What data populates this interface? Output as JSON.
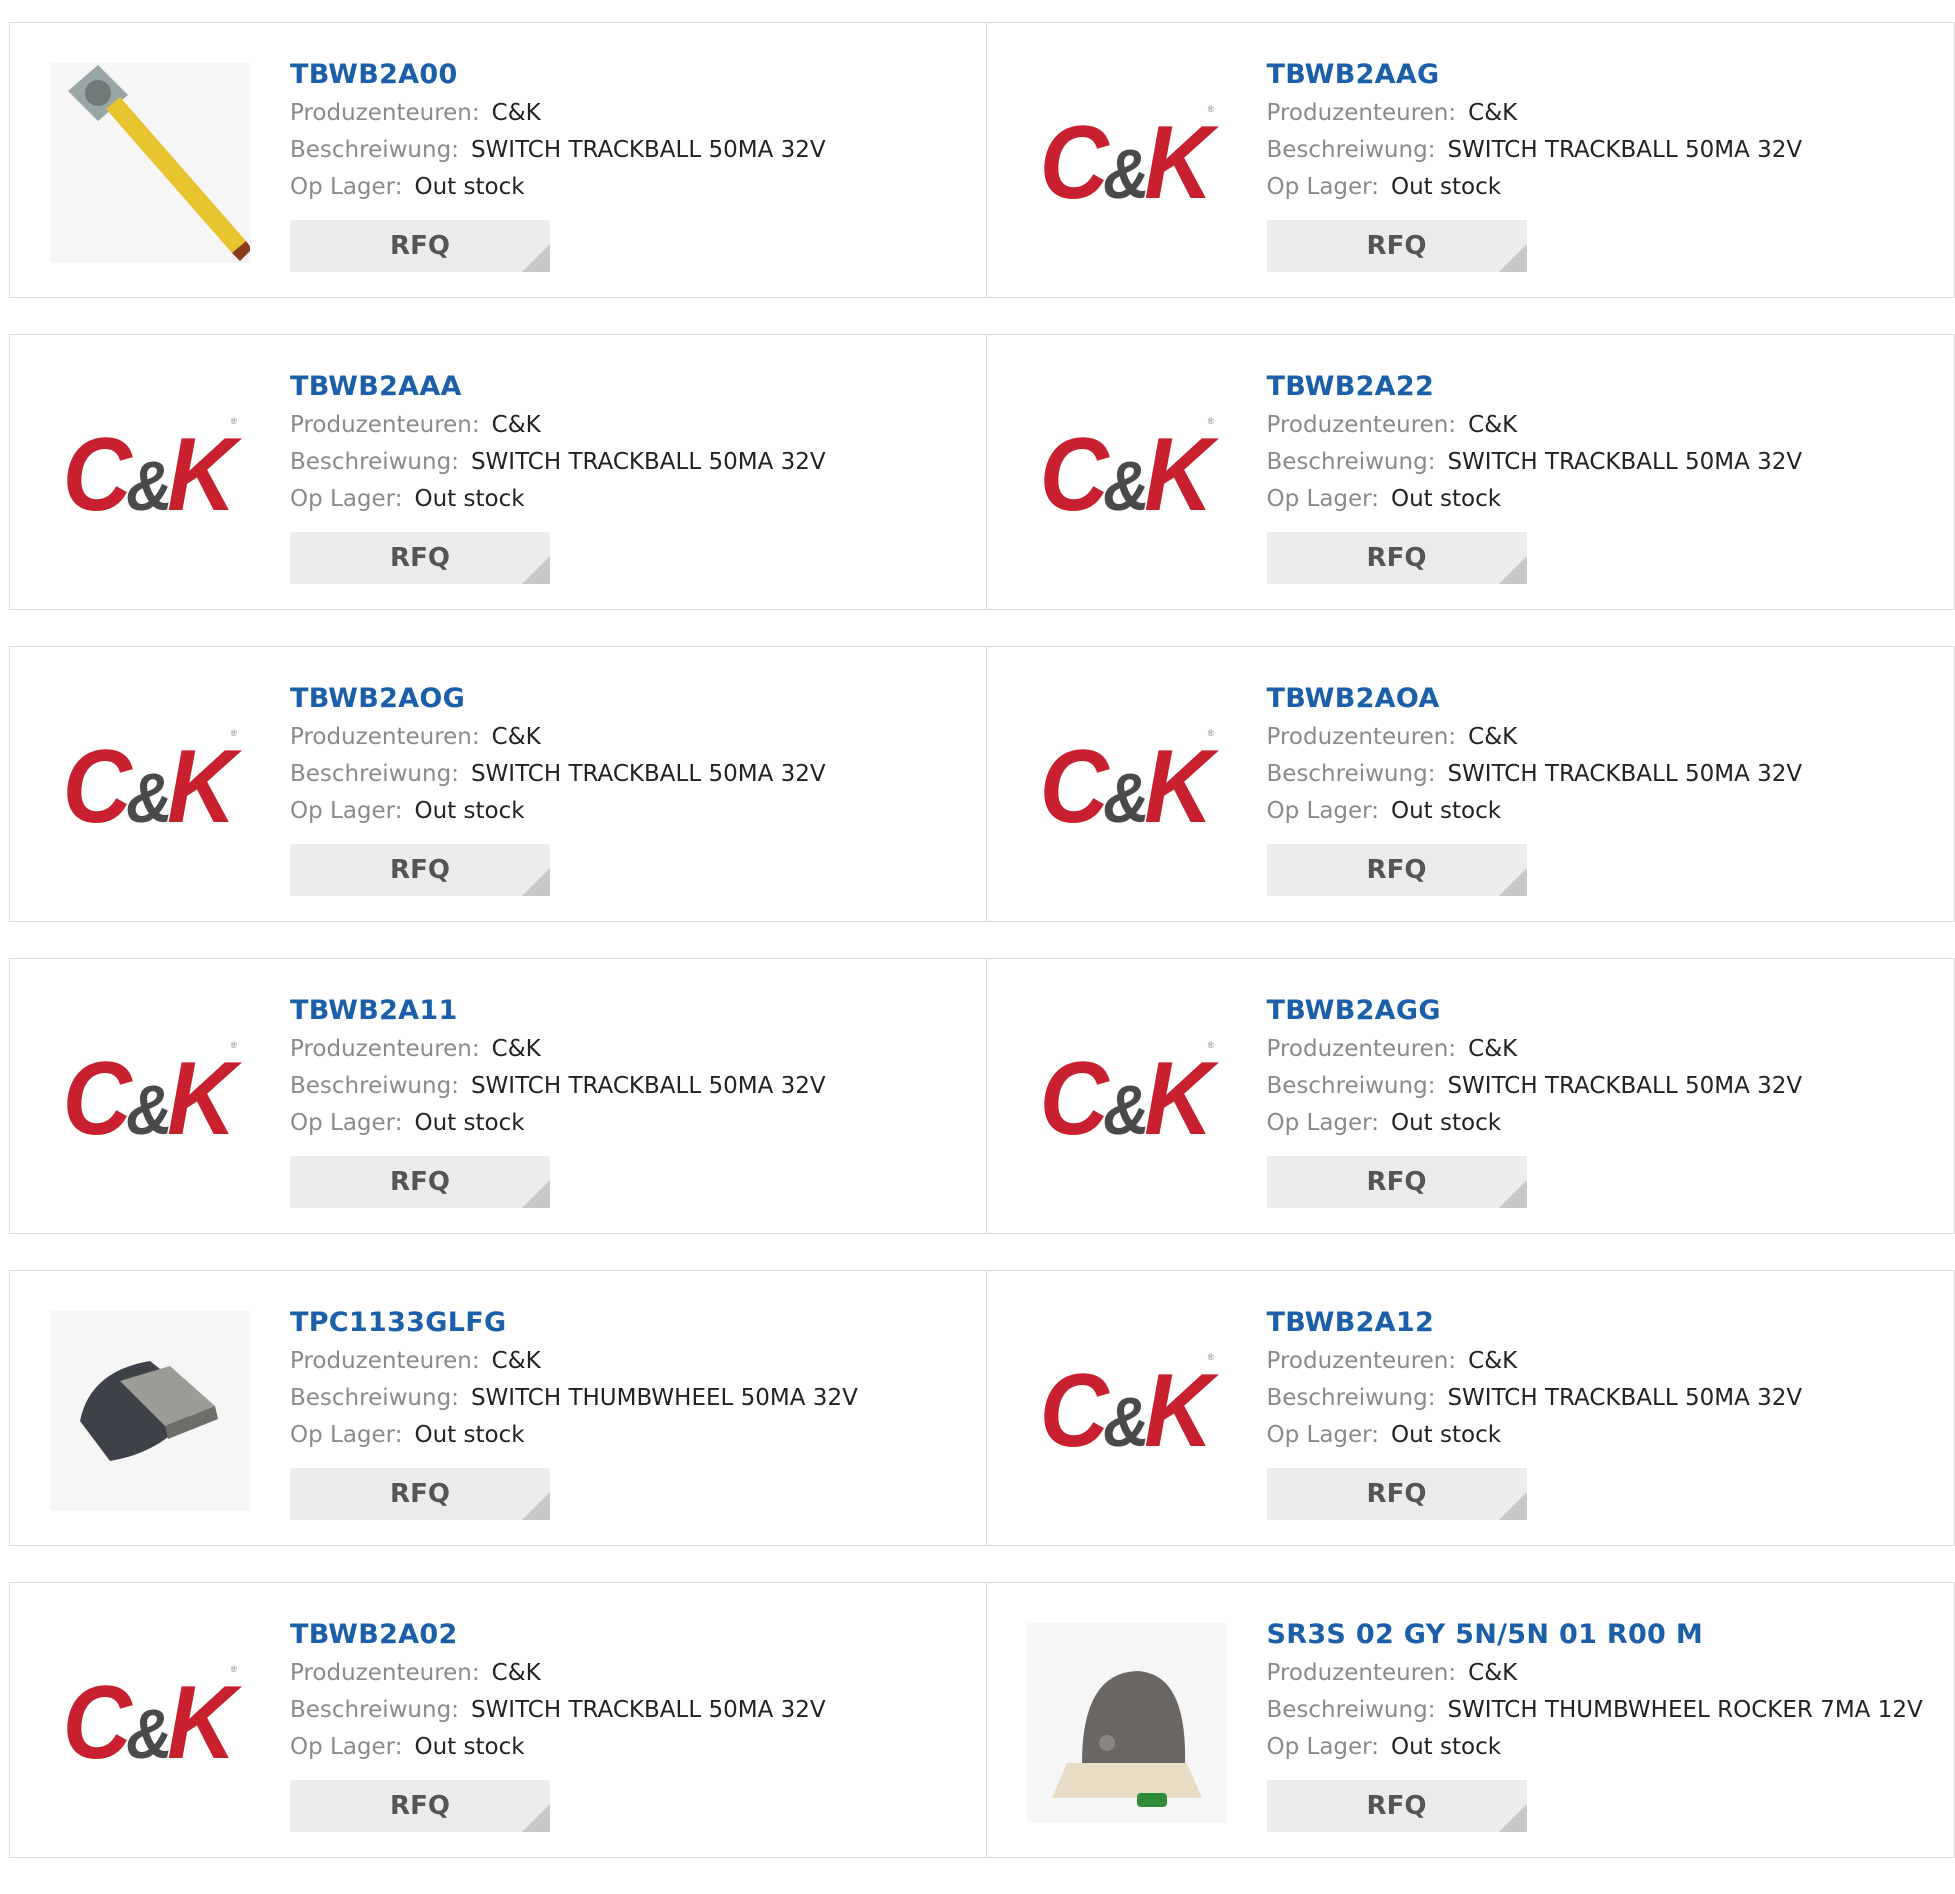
{
  "labels": {
    "manufacturer": "Produzenteuren:",
    "description": "Beschreiwung:",
    "stock": "Op Lager:",
    "rfq": "RFQ"
  },
  "logo": {
    "brand_c": "C",
    "brand_amp": "&",
    "brand_k": "K",
    "reg": "®"
  },
  "products": [
    {
      "pn": "TBWB2A00",
      "mfr": "C&K",
      "desc": "SWITCH TRACKBALL 50MA 32V",
      "stock": "Out stock",
      "image": "trackball-flex-photo"
    },
    {
      "pn": "TBWB2AAG",
      "mfr": "C&K",
      "desc": "SWITCH TRACKBALL 50MA 32V",
      "stock": "Out stock",
      "image": "ck-logo"
    },
    {
      "pn": "TBWB2AAA",
      "mfr": "C&K",
      "desc": "SWITCH TRACKBALL 50MA 32V",
      "stock": "Out stock",
      "image": "ck-logo"
    },
    {
      "pn": "TBWB2A22",
      "mfr": "C&K",
      "desc": "SWITCH TRACKBALL 50MA 32V",
      "stock": "Out stock",
      "image": "ck-logo"
    },
    {
      "pn": "TBWB2AOG",
      "mfr": "C&K",
      "desc": "SWITCH TRACKBALL 50MA 32V",
      "stock": "Out stock",
      "image": "ck-logo"
    },
    {
      "pn": "TBWB2AOA",
      "mfr": "C&K",
      "desc": "SWITCH TRACKBALL 50MA 32V",
      "stock": "Out stock",
      "image": "ck-logo"
    },
    {
      "pn": "TBWB2A11",
      "mfr": "C&K",
      "desc": "SWITCH TRACKBALL 50MA 32V",
      "stock": "Out stock",
      "image": "ck-logo"
    },
    {
      "pn": "TBWB2AGG",
      "mfr": "C&K",
      "desc": "SWITCH TRACKBALL 50MA 32V",
      "stock": "Out stock",
      "image": "ck-logo"
    },
    {
      "pn": "TPC1133GLFG",
      "mfr": "C&K",
      "desc": "SWITCH THUMBWHEEL 50MA 32V",
      "stock": "Out stock",
      "image": "thumbwheel-photo"
    },
    {
      "pn": "TBWB2A12",
      "mfr": "C&K",
      "desc": "SWITCH TRACKBALL 50MA 32V",
      "stock": "Out stock",
      "image": "ck-logo"
    },
    {
      "pn": "TBWB2A02",
      "mfr": "C&K",
      "desc": "SWITCH TRACKBALL 50MA 32V",
      "stock": "Out stock",
      "image": "ck-logo"
    },
    {
      "pn": "SR3S 02 GY 5N/5N 01 R00 M",
      "mfr": "C&K",
      "desc": "SWITCH THUMBWHEEL ROCKER 7MA 12V",
      "stock": "Out stock",
      "image": "rocker-photo"
    }
  ]
}
